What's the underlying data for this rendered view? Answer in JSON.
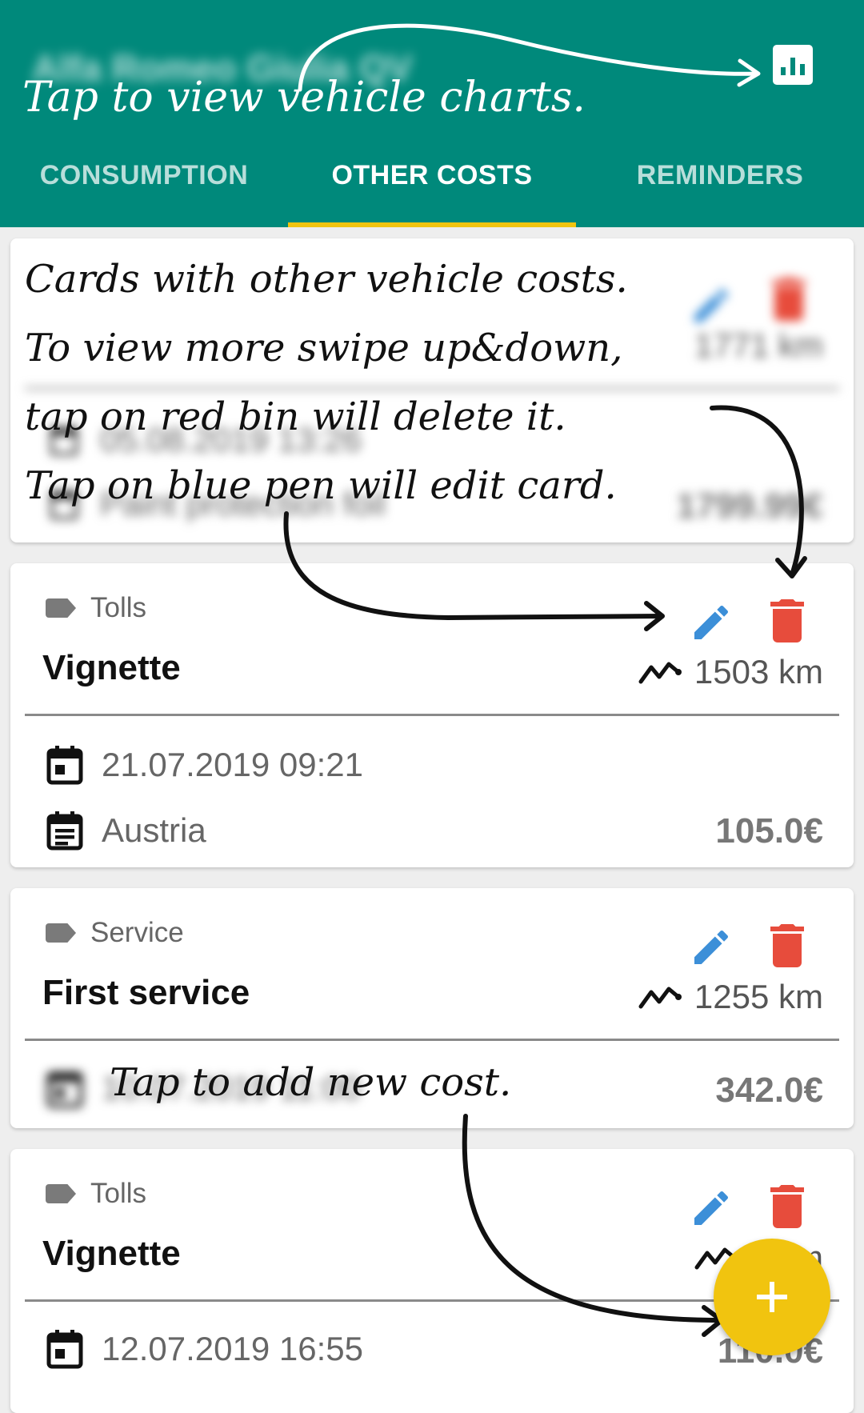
{
  "header": {
    "vehicle_name": "Alfa Romeo Giulia QV",
    "charts_icon": "bar-chart-icon",
    "tabs": [
      {
        "label": "CONSUMPTION",
        "active": false
      },
      {
        "label": "OTHER COSTS",
        "active": true
      },
      {
        "label": "REMINDERS",
        "active": false
      }
    ],
    "accent_color": "#00897b",
    "indicator_color": "#f1c40f"
  },
  "cards": [
    {
      "category": "",
      "title": "",
      "odometer": "1771 km",
      "date": "05.08.2019 13:26",
      "note": "Paint protection foil",
      "price": "1799.99€"
    },
    {
      "category": "Tolls",
      "title": "Vignette",
      "odometer": "1503 km",
      "date": "21.07.2019 09:21",
      "note": "Austria",
      "price": "105.0€"
    },
    {
      "category": "Service",
      "title": "First service",
      "odometer": "1255 km",
      "date": "10.07.2019 11:00",
      "price": "342.0€"
    },
    {
      "category": "Tolls",
      "title": "Vignette",
      "odometer": "3 km",
      "date": "12.07.2019 16:55",
      "price": "110.0€"
    }
  ],
  "tutorial": {
    "charts_hint": "Tap to view vehicle charts.",
    "cards_hint": [
      "Cards with other vehicle costs.",
      "To view more swipe up&down,",
      "tap on red bin will delete it.",
      "Tap on blue pen will edit card."
    ],
    "add_hint": "Tap to add new cost."
  },
  "fab": {
    "label": "+",
    "color": "#f1c40f"
  },
  "colors": {
    "edit": "#3c8fd8",
    "delete": "#e74c3c"
  }
}
